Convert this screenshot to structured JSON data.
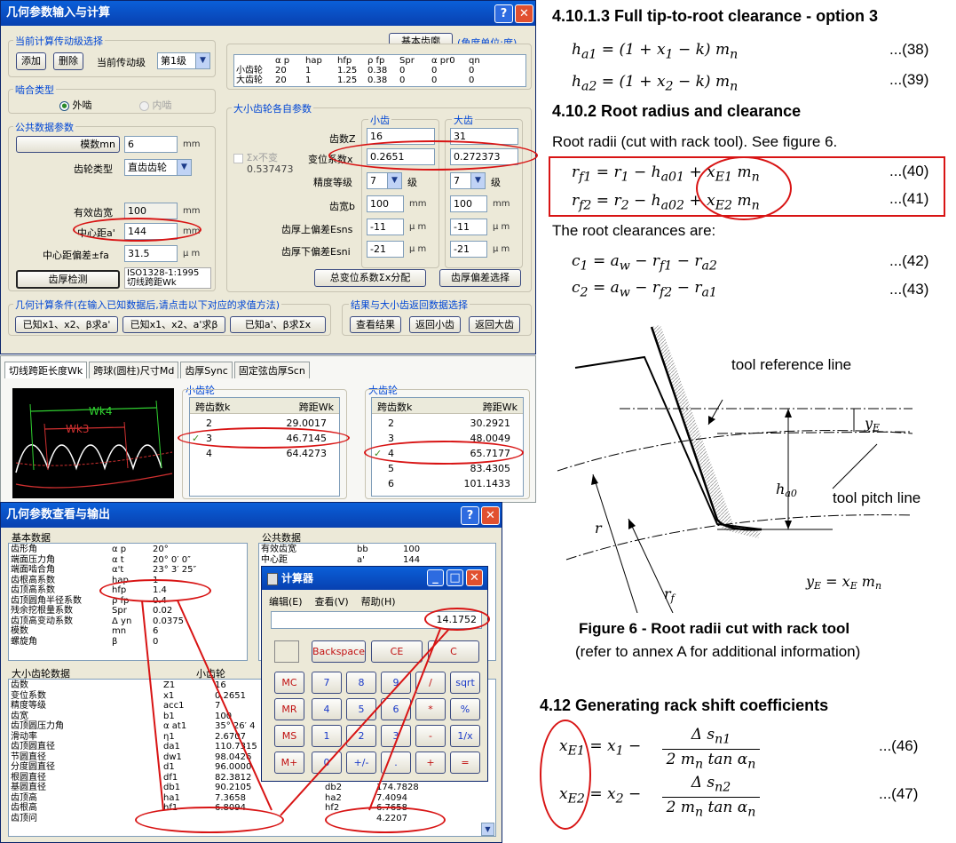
{
  "win1": {
    "title": "几何参数输入与计算",
    "grp_level": "当前计算传动级选择",
    "add": "添加",
    "del": "删除",
    "cur_level_label": "当前传动级",
    "cur_level": "第1级",
    "basic_rack_btn": "基本齿廓",
    "angle_unit": "(角度单位:度)",
    "rack_headers": [
      "α p",
      "hap",
      "hfp",
      "ρ fp",
      "Spr",
      "α pr0",
      "qn"
    ],
    "rack_rows": [
      {
        "name": "小齿轮",
        "vals": [
          "20",
          "1",
          "1.25",
          "0.38",
          "0",
          "0",
          "0"
        ]
      },
      {
        "name": "大齿轮",
        "vals": [
          "20",
          "1",
          "1.25",
          "0.38",
          "0",
          "0",
          "0"
        ]
      }
    ],
    "grp_mesh": "啮合类型",
    "mesh_ext": "外啮",
    "mesh_int": "内啮",
    "grp_common": "公共数据参数",
    "module_btn": "模数mn",
    "module_val": "6",
    "module_unit": "mm",
    "gear_type_label": "齿轮类型",
    "gear_type": "直齿齿轮",
    "face_width_label": "有效齿宽",
    "face_width": "100",
    "fw_unit": "mm",
    "center_label": "中心距a'",
    "center_val": "144",
    "center_unit": "mm",
    "center_dev_label": "中心距偏差±fa",
    "center_dev": "31.5",
    "cd_unit": "μ m",
    "thick_check_btn": "齿厚检测",
    "std_note1": "ISO1328-1:1995",
    "std_note2": "切线跨距Wk",
    "grp_each": "大小齿轮各自参数",
    "small": "小齿",
    "large": "大齿",
    "z_label": "齿数Z",
    "z1": "16",
    "z2": "31",
    "sum_fixed": "Σx不变",
    "sum_val": "0.537473",
    "x_label": "变位系数x",
    "x1": "0.2651",
    "x2": "0.272373",
    "acc_label": "精度等级",
    "acc1": "7",
    "acc2": "7",
    "acc_unit": "级",
    "b_label": "齿宽b",
    "b1": "100",
    "b2": "100",
    "b_unit": "mm",
    "esns_label": "齿厚上偏差Esns",
    "esns1": "-11",
    "esns2": "-11",
    "es_unit": "μ m",
    "esni_label": "齿厚下偏差Esni",
    "esni1": "-21",
    "esni2": "-21",
    "dist_btn": "总变位系数Σx分配",
    "thick_dev_btn": "齿厚偏差选择",
    "grp_cond": "几何计算条件(在输入已知数据后,请点击以下对应的求值方法)",
    "cond1": "已知x1、x2、β求a'",
    "cond2": "已知x1、x2、a'求β",
    "cond3": "已知a'、β求Σx",
    "grp_result": "结果与大小齿返回数据选择",
    "view_btn": "查看结果",
    "ret_small": "返回小齿",
    "ret_large": "返回大齿"
  },
  "tabs": [
    "切线跨距长度Wk",
    "跨球(圆柱)尺寸Md",
    "齿厚Sync",
    "固定弦齿厚Scn"
  ],
  "wk_fig": {
    "wk4": "Wk4",
    "wk3": "Wk3"
  },
  "small_list": {
    "title": "小齿轮",
    "col1": "跨齿数k",
    "col2": "跨距Wk",
    "rows": [
      [
        "2",
        "29.0017"
      ],
      [
        "3",
        "46.7145"
      ],
      [
        "4",
        "64.4273"
      ]
    ]
  },
  "large_list": {
    "title": "大齿轮",
    "col1": "跨齿数k",
    "col2": "跨距Wk",
    "rows": [
      [
        "2",
        "30.2921"
      ],
      [
        "3",
        "48.0049"
      ],
      [
        "4",
        "65.7177"
      ],
      [
        "5",
        "83.4305"
      ],
      [
        "6",
        "101.1433"
      ]
    ]
  },
  "win2": {
    "title": "几何参数查看与输出",
    "basic": "基本数据",
    "common": "公共数据",
    "basic_rows": [
      [
        "齿形角",
        "α p",
        "20°"
      ],
      [
        "端面压力角",
        "α t",
        "20° 0′ 0″"
      ],
      [
        "端面啮合角",
        "α't",
        "23° 3′ 25″"
      ],
      [
        "齿根高系数",
        "hap",
        "1"
      ],
      [
        "齿顶高系数",
        "hfp",
        "1.4"
      ],
      [
        "齿顶圆角半径系数",
        "ρ fp",
        "0.4"
      ],
      [
        "残余挖根量系数",
        "Spr",
        "0.02"
      ],
      [
        "齿顶高变动系数",
        "Δ yn",
        "0.0375"
      ],
      [
        "模数",
        "mn",
        "6"
      ],
      [
        "螺旋角",
        "β",
        "0"
      ]
    ],
    "common_rows": [
      [
        "有效齿宽",
        "bb",
        "100"
      ],
      [
        "中心距",
        "a'",
        "144"
      ]
    ],
    "each": "大小齿轮数据",
    "small_col": "小齿轮",
    "each_rows": [
      [
        "齿数",
        "Z1",
        "16",
        "",
        ""
      ],
      [
        "变位系数",
        "x1",
        "0.2651",
        "",
        ""
      ],
      [
        "精度等级",
        "acc1",
        "7",
        "",
        ""
      ],
      [
        "齿宽",
        "b1",
        "100",
        "",
        ""
      ],
      [
        "齿顶圆压力角",
        "α at1",
        "35° 26′ 4",
        "",
        ""
      ],
      [
        "滑动率",
        "η1",
        "2.6707",
        "",
        ""
      ],
      [
        "齿顶圆直径",
        "da1",
        "110.7315",
        "",
        ""
      ],
      [
        "节圆直径",
        "dw1",
        "98.0426",
        "",
        ""
      ],
      [
        "分度圆直径",
        "d1",
        "96.0000",
        "",
        ""
      ],
      [
        "根圆直径",
        "df1",
        "82.3812",
        "df2",
        "172.4685"
      ],
      [
        "基圆直径",
        "db1",
        "90.2105",
        "db2",
        "174.7828"
      ],
      [
        "齿顶高",
        "ha1",
        "7.3658",
        "ha2",
        "7.4094"
      ],
      [
        "齿根高",
        "hf1",
        "6.8094",
        "hf2",
        "6.7658"
      ],
      [
        "齿顶问",
        "",
        "",
        "",
        "4.2207"
      ]
    ]
  },
  "calc": {
    "title": "计算器",
    "menu": [
      "编辑(E)",
      "查看(V)",
      "帮助(H)"
    ],
    "display": "14.1752",
    "backspace": "Backspace",
    "ce": "CE",
    "c": "C",
    "rows": [
      [
        "MC",
        "7",
        "8",
        "9",
        "/",
        "sqrt"
      ],
      [
        "MR",
        "4",
        "5",
        "6",
        "*",
        "%"
      ],
      [
        "MS",
        "1",
        "2",
        "3",
        "-",
        "1/x"
      ],
      [
        "M+",
        "0",
        "+/-",
        ".",
        "+",
        "="
      ]
    ]
  },
  "doc": {
    "h1": "4.10.1.3 Full tip-to-root clearance - option 3",
    "eq38": "...(38)",
    "eq39": "...(39)",
    "h2": "4.10.2 Root radius and clearance",
    "p1": "Root radii (cut with rack tool). See figure 6.",
    "eq40": "...(40)",
    "eq41": "...(41)",
    "p2": "The root clearances are:",
    "eq42": "...(42)",
    "eq43": "...(43)",
    "fig_ref": "tool reference line",
    "fig_pitch": "tool pitch line",
    "fig_cap1": "Figure 6 - Root radii cut with rack tool",
    "fig_cap2": "(refer to annex A for additional information)",
    "h3": "4.12  Generating rack shift coefficients",
    "eq46": "...(46)",
    "eq47": "...(47)"
  }
}
